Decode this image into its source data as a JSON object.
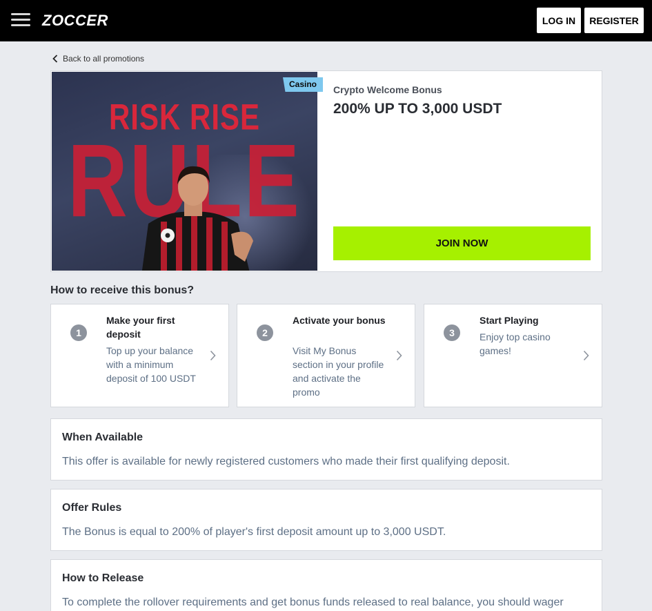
{
  "header": {
    "logo_text": "ZOCCER",
    "login_label": "LOG IN",
    "register_label": "REGISTER"
  },
  "back_link": {
    "label": "Back to all promotions"
  },
  "promo": {
    "banner_line1": "RISK RISE",
    "banner_line2": "RULE",
    "tag": "Casino",
    "subtitle": "Crypto Welcome Bonus",
    "title": "200% UP TO 3,000 USDT",
    "join_label": "JOIN NOW"
  },
  "how_to": {
    "title": "How to receive this bonus?",
    "steps": [
      {
        "number": "1",
        "title": "Make your first deposit",
        "description": "Top up your balance with a minimum deposit of 100 USDT"
      },
      {
        "number": "2",
        "title": "Activate your bonus",
        "description": "Visit My Bonus section in your profile and activate the promo"
      },
      {
        "number": "3",
        "title": "Start Playing",
        "description": "Enjoy top casino games!"
      }
    ]
  },
  "sections": {
    "when_available": {
      "title": "When Available",
      "body": "This offer is available for newly registered customers who made their first qualifying deposit."
    },
    "offer_rules": {
      "title": "Offer Rules",
      "body": "The Bonus is equal to 200% of player's first deposit amount up to 3,000 USDT."
    },
    "how_to_release": {
      "title": "How to Release",
      "body": "To complete the rollover requirements and get bonus funds released to real balance, you should wager"
    }
  },
  "colors": {
    "accent": "#a6f000",
    "header_bg": "#000000",
    "tag_bg": "#7ec8ee",
    "page_bg": "#e9ebef",
    "muted_text": "#5d6f85"
  },
  "icons": {
    "menu": "hamburger-icon",
    "back": "chevron-left-icon",
    "step_arrow": "chevron-right-icon"
  }
}
